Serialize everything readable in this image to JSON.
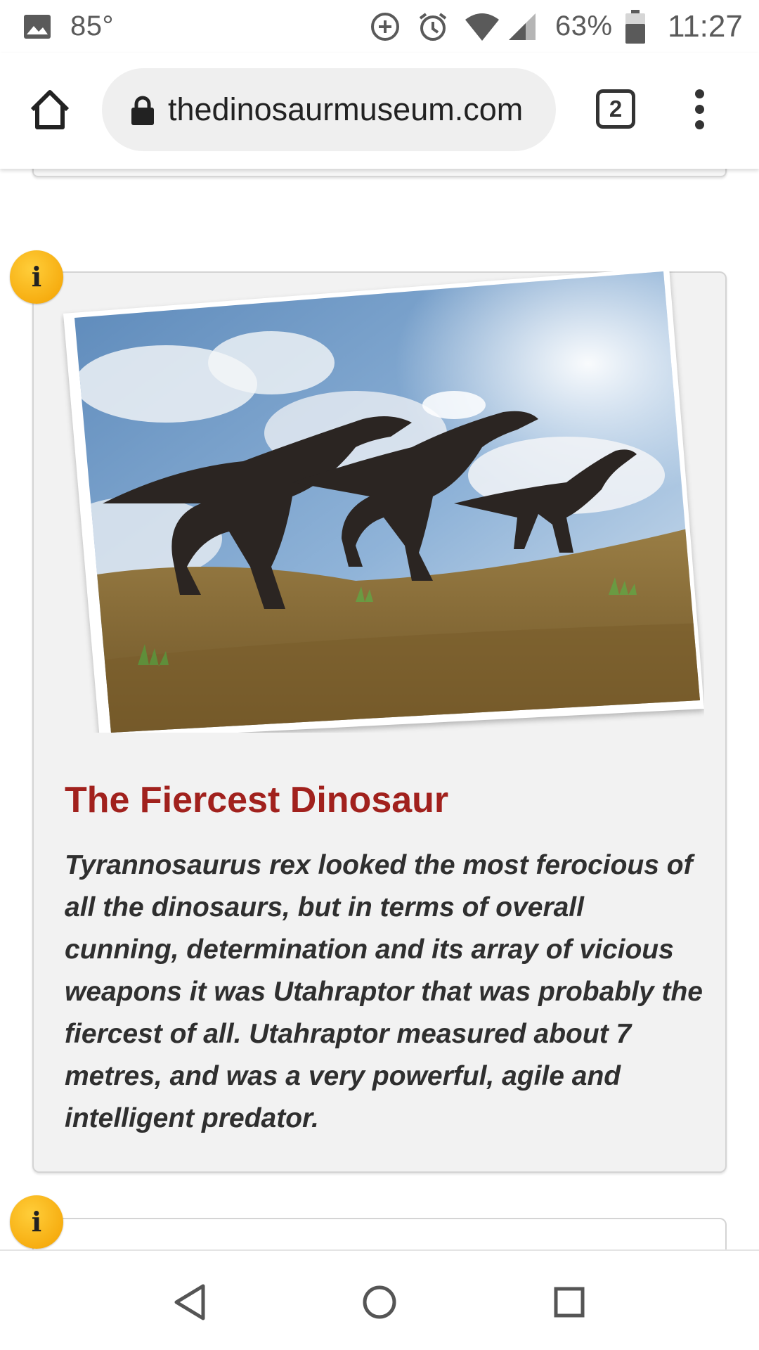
{
  "status_bar": {
    "temperature": "85°",
    "battery": "63%",
    "time": "11:27",
    "icons": [
      "image-icon",
      "data-saver-icon",
      "alarm-icon",
      "wifi-icon",
      "signal-icon",
      "battery-icon"
    ]
  },
  "browser": {
    "url": "thedinosaurmuseum.com",
    "tab_count": "2",
    "icons": [
      "home-icon",
      "lock-icon",
      "overflow-menu-icon"
    ]
  },
  "article": {
    "info_badge": "i",
    "title": "The Fiercest Dinosaur",
    "body": "Tyrannosaurus rex looked the most ferocious of all the dinosaurs, but in terms of overall cunning, determination and its array of vicious weapons it was Utahraptor that was probably the fiercest of all. Utahraptor measured about 7 metres, and was a very powerful, agile and intelligent predator.",
    "image": "utahraptor-pack-photo"
  },
  "next_article": {
    "info_badge": "i"
  },
  "colors": {
    "title": "#a1211d",
    "badge": "#f3a000",
    "card_bg": "#f2f2f2"
  },
  "nav": {
    "icons": [
      "back-icon",
      "home-circle-icon",
      "recents-icon"
    ]
  }
}
